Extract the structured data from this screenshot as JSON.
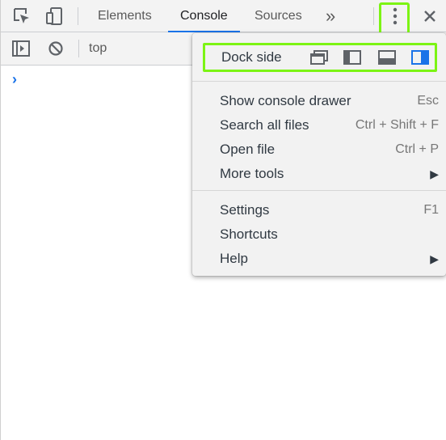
{
  "tabs": [
    {
      "label": "Elements",
      "active": false
    },
    {
      "label": "Console",
      "active": true
    },
    {
      "label": "Sources",
      "active": false
    }
  ],
  "more_tabs_glyph": "»",
  "context": "top",
  "prompt_glyph": "›",
  "menu": {
    "dock_label": "Dock side",
    "dock_options": [
      "undock-icon",
      "dock-left-icon",
      "dock-bottom-icon",
      "dock-right-icon"
    ],
    "dock_selected": "dock-right-icon",
    "items": [
      {
        "label": "Show console drawer",
        "shortcut": "Esc"
      },
      {
        "label": "Search all files",
        "shortcut": "Ctrl + Shift + F"
      },
      {
        "label": "Open file",
        "shortcut": "Ctrl + P"
      },
      {
        "label": "More tools",
        "shortcut": "",
        "submenu": true
      },
      {
        "label": "Settings",
        "shortcut": "F1"
      },
      {
        "label": "Shortcuts",
        "shortcut": ""
      },
      {
        "label": "Help",
        "shortcut": "",
        "submenu": true
      }
    ],
    "submenu_glyph": "▶"
  },
  "colors": {
    "accent": "#1a73e8",
    "highlight": "#7cf414",
    "panel_bg": "#f3f3f3",
    "menu_bg": "#f2f2f2"
  }
}
